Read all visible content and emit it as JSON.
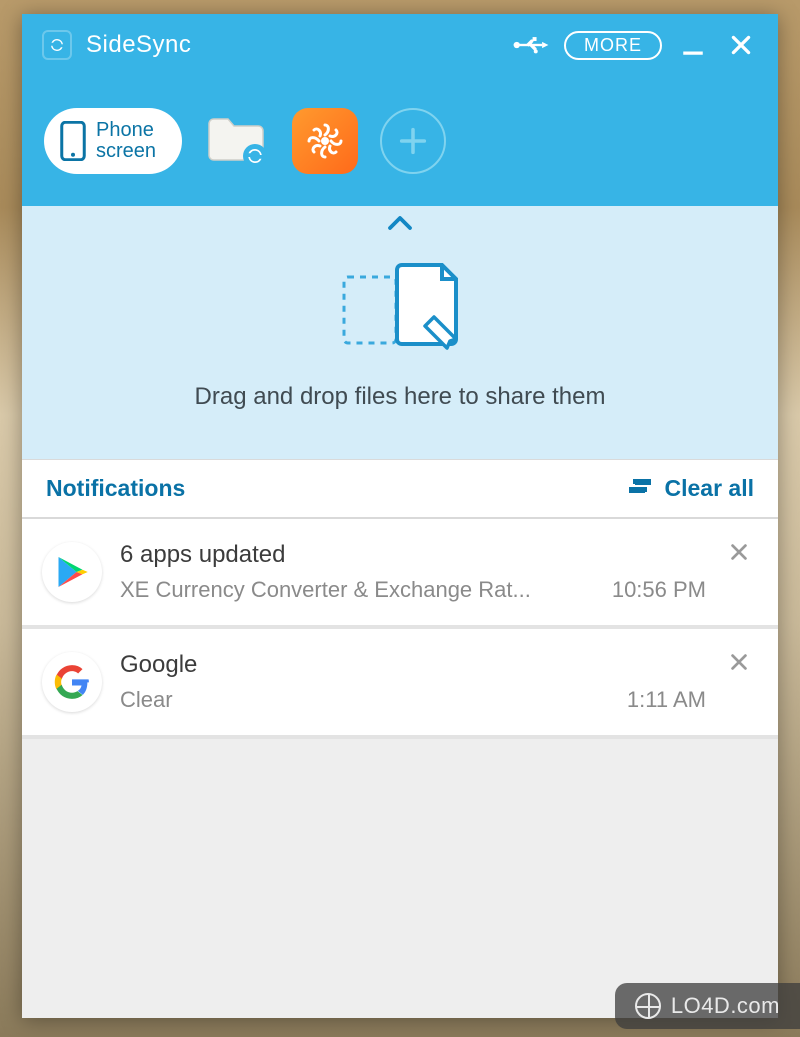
{
  "titlebar": {
    "app_name": "SideSync",
    "more_label": "MORE"
  },
  "toolbar": {
    "phone_label": "Phone\nscreen"
  },
  "dropzone": {
    "text": "Drag and drop files here to share them"
  },
  "notifications": {
    "header_label": "Notifications",
    "clear_all_label": "Clear all",
    "items": [
      {
        "icon": "play-store-icon",
        "title": "6 apps updated",
        "subtitle": "XE Currency Converter & Exchange Rat...",
        "time": "10:56 PM"
      },
      {
        "icon": "google-icon",
        "title": "Google",
        "subtitle": "Clear",
        "time": "1:11 AM"
      }
    ]
  },
  "watermark": {
    "text": "LO4D.com"
  }
}
